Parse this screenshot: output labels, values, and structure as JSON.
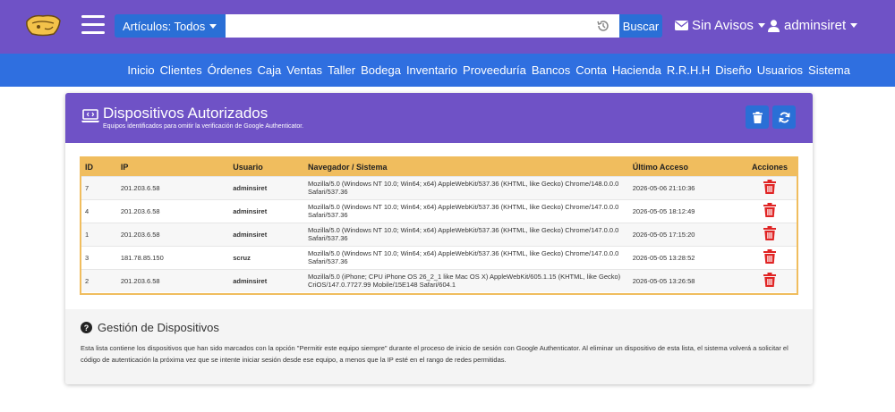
{
  "topbar": {
    "filter_label": "Artículos: Todos",
    "search_value": "",
    "search_button": "Buscar",
    "notices_label": "Sin Avisos",
    "user_label": "adminsiret"
  },
  "nav": [
    "Inicio",
    "Clientes",
    "Órdenes",
    "Caja",
    "Ventas",
    "Taller",
    "Bodega",
    "Inventario",
    "Proveeduría",
    "Bancos",
    "Conta",
    "Hacienda",
    "R.R.H.H",
    "Diseño",
    "Usuarios",
    "Sistema"
  ],
  "card": {
    "title": "Dispositivos Autorizados",
    "subtitle": "Equipos identificados para omitir la verificación de Google Authenticator."
  },
  "table": {
    "headers": [
      "ID",
      "IP",
      "Usuario",
      "Navegador / Sistema",
      "Último Acceso",
      "Acciones"
    ],
    "rows": [
      {
        "id": "7",
        "ip": "201.203.6.58",
        "user": "adminsiret",
        "agent": "Mozilla/5.0 (Windows NT 10.0; Win64; x64) AppleWebKit/537.36 (KHTML, like Gecko) Chrome/148.0.0.0 Safari/537.36",
        "last": "2026-05-06 21:10:36"
      },
      {
        "id": "4",
        "ip": "201.203.6.58",
        "user": "adminsiret",
        "agent": "Mozilla/5.0 (Windows NT 10.0; Win64; x64) AppleWebKit/537.36 (KHTML, like Gecko) Chrome/147.0.0.0 Safari/537.36",
        "last": "2026-05-05 18:12:49"
      },
      {
        "id": "1",
        "ip": "201.203.6.58",
        "user": "adminsiret",
        "agent": "Mozilla/5.0 (Windows NT 10.0; Win64; x64) AppleWebKit/537.36 (KHTML, like Gecko) Chrome/147.0.0.0 Safari/537.36",
        "last": "2026-05-05 17:15:20"
      },
      {
        "id": "3",
        "ip": "181.78.85.150",
        "user": "scruz",
        "agent": "Mozilla/5.0 (Windows NT 10.0; Win64; x64) AppleWebKit/537.36 (KHTML, like Gecko) Chrome/147.0.0.0 Safari/537.36",
        "last": "2026-05-05 13:28:52"
      },
      {
        "id": "2",
        "ip": "201.203.6.58",
        "user": "adminsiret",
        "agent": "Mozilla/5.0 (iPhone; CPU iPhone OS 26_2_1 like Mac OS X) AppleWebKit/605.1.15 (KHTML, like Gecko) CriOS/147.0.7727.99 Mobile/15E148 Safari/604.1",
        "last": "2026-05-05 13:26:58"
      }
    ]
  },
  "info": {
    "title": "Gestión de Dispositivos",
    "text": "Esta lista contiene los dispositivos que han sido marcados con la opción \"Permitir este equipo siempre\" durante el proceso de inicio de sesión con Google Authenticator. Al eliminar un dispositivo de esta lista, el sistema volverá a solicitar el código de autenticación la próxima vez que se intente iniciar sesión desde ese equipo, a menos que la IP esté en el rango de redes permitidas."
  },
  "colors": {
    "header_purple": "#6f52c6",
    "nav_blue": "#2f6fe0",
    "button_blue": "#2a6fd6",
    "table_header": "#f0bd5e",
    "danger_red": "#e02424"
  },
  "icons": [
    "logo-icon",
    "hamburger-icon",
    "history-icon",
    "envelope-icon",
    "user-icon",
    "device-icon",
    "trash-icon",
    "refresh-icon",
    "question-icon"
  ]
}
